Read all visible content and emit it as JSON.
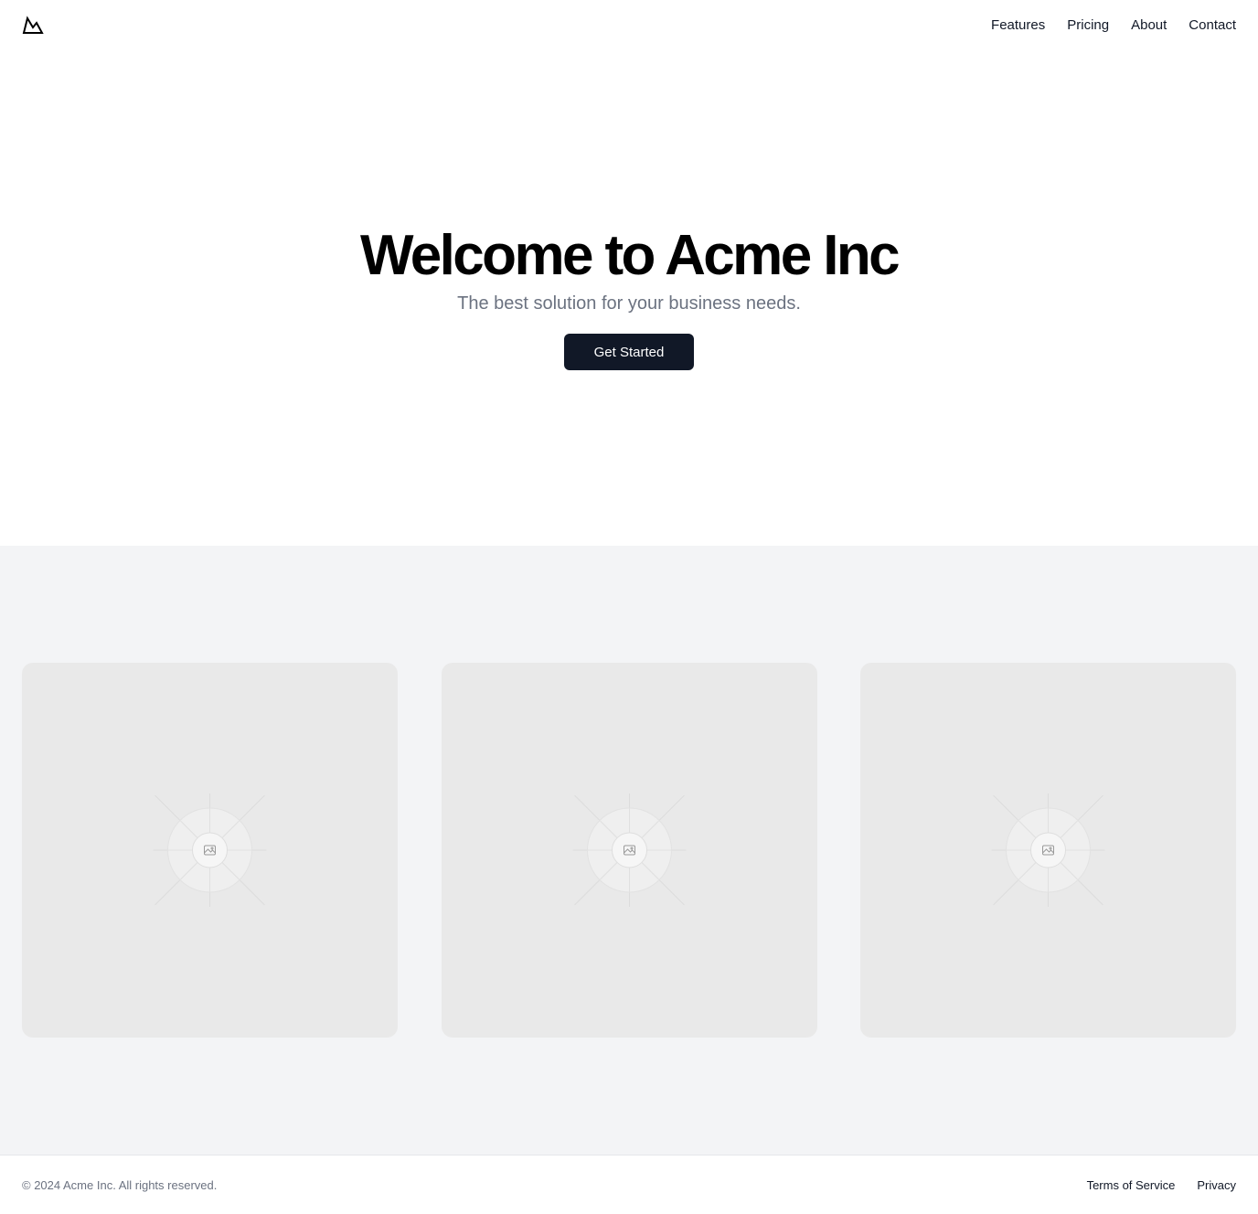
{
  "header": {
    "logo_icon": "mountain-icon",
    "nav": [
      {
        "label": "Features"
      },
      {
        "label": "Pricing"
      },
      {
        "label": "About"
      },
      {
        "label": "Contact"
      }
    ]
  },
  "hero": {
    "title": "Welcome to Acme Inc",
    "subtitle": "The best solution for your business needs.",
    "cta_label": "Get Started"
  },
  "features": {
    "cards": [
      {
        "icon": "image-placeholder-icon"
      },
      {
        "icon": "image-placeholder-icon"
      },
      {
        "icon": "image-placeholder-icon"
      }
    ]
  },
  "footer": {
    "copyright": "© 2024 Acme Inc. All rights reserved.",
    "links": [
      {
        "label": "Terms of Service"
      },
      {
        "label": "Privacy"
      }
    ]
  },
  "colors": {
    "primary": "#111827",
    "muted_text": "#6b7280",
    "section_bg": "#f3f4f6",
    "placeholder_bg": "#e9e9e9"
  }
}
